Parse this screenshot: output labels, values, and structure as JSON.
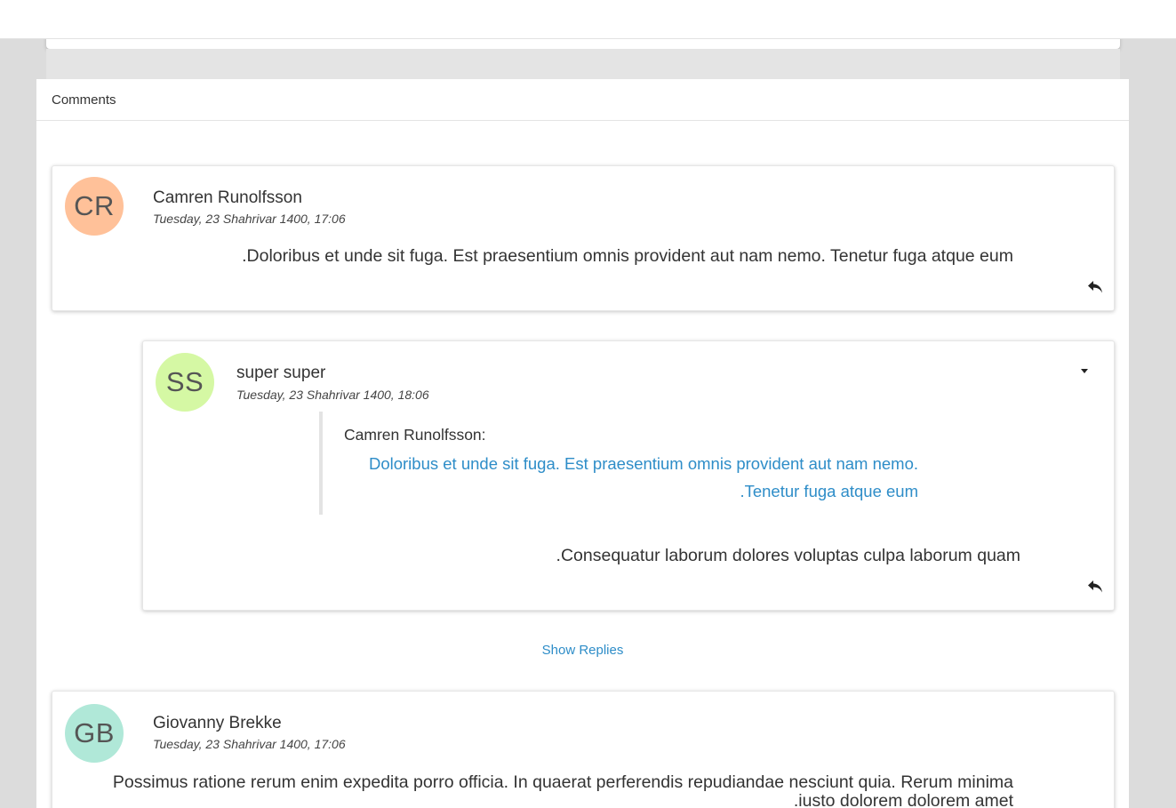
{
  "panel": {
    "title": "Comments"
  },
  "comments": [
    {
      "initials": "CR",
      "avatar_color": "#ffc199",
      "author": "Camren Runolfsson",
      "date": "Tuesday, 23 Shahrivar 1400, 17:06",
      "body": "Doloribus et unde sit fuga. Est praesentium omnis provident aut nam nemo. Tenetur fuga atque eum."
    },
    {
      "initials": "SS",
      "avatar_color": "#d5f8a4",
      "author": "super super",
      "date": "Tuesday, 23 Shahrivar 1400, 18:06",
      "quote": {
        "author": "Camren Runolfsson:",
        "text": "Doloribus et unde sit fuga. Est praesentium omnis provident aut nam nemo. Tenetur fuga atque eum."
      },
      "body": "Consequatur laborum dolores voluptas culpa laborum quam."
    },
    {
      "initials": "GB",
      "avatar_color": "#b0e8d8",
      "author": "Giovanny Brekke",
      "date": "Tuesday, 23 Shahrivar 1400, 17:06",
      "body": "Possimus ratione rerum enim expedita porro officia. In quaerat perferendis repudiandae nesciunt quia. Rerum minima iusto dolorem dolorem amet."
    }
  ],
  "show_replies_label": "Show Replies",
  "icons": {
    "reply": "reply-icon",
    "dropdown": "caret-down-icon"
  },
  "colors": {
    "link": "#2e8dc8",
    "background": "#dcdcdc"
  }
}
